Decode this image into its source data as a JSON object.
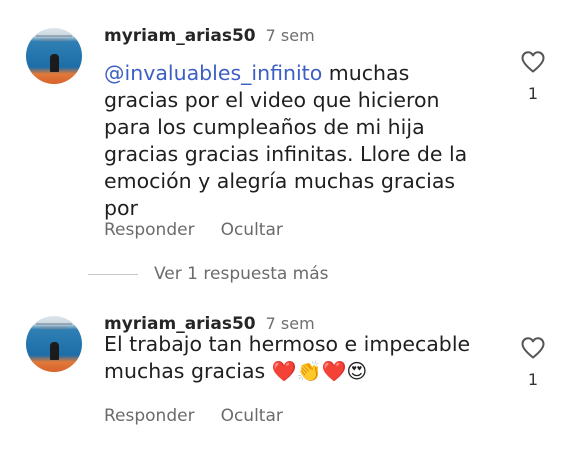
{
  "comments": [
    {
      "username": "myriam_arias50",
      "time": "7 sem",
      "mention": "@invaluables_infinito",
      "text": " muchas gracias por el video que hicieron para los cumpleaños de mi hija gracias gracias infinitas. Llore de la emoción y alegría muchas gracias por",
      "like_count": "1",
      "reply_label": "Responder",
      "hide_label": "Ocultar"
    },
    {
      "username": "myriam_arias50",
      "time": "7 sem",
      "text": "El trabajo tan hermoso e impecable muchas gracias ",
      "emojis": "❤️👏❤️😍",
      "like_count": "1",
      "reply_label": "Responder",
      "hide_label": "Ocultar"
    }
  ],
  "more_replies_label": "Ver 1 respuesta más",
  "icons": {
    "avatar": "profile-photo",
    "like": "heart-outline-icon"
  }
}
